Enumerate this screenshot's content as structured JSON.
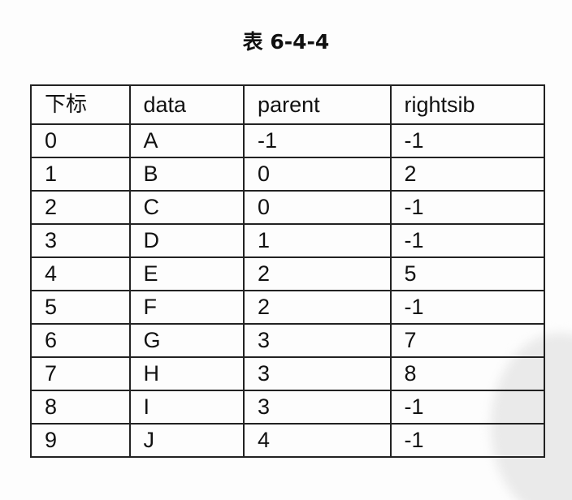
{
  "caption": "表 6-4-4",
  "table": {
    "headers": [
      "下标",
      "data",
      "parent",
      "rightsib"
    ],
    "rows": [
      [
        "0",
        "A",
        "-1",
        "-1"
      ],
      [
        "1",
        "B",
        "0",
        "2"
      ],
      [
        "2",
        "C",
        "0",
        "-1"
      ],
      [
        "3",
        "D",
        "1",
        "-1"
      ],
      [
        "4",
        "E",
        "2",
        "5"
      ],
      [
        "5",
        "F",
        "2",
        "-1"
      ],
      [
        "6",
        "G",
        "3",
        "7"
      ],
      [
        "7",
        "H",
        "3",
        "8"
      ],
      [
        "8",
        "I",
        "3",
        "-1"
      ],
      [
        "9",
        "J",
        "4",
        "-1"
      ]
    ]
  }
}
